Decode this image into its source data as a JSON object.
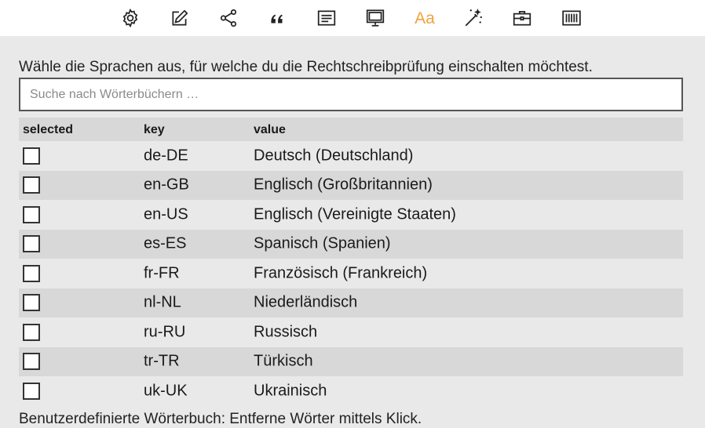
{
  "toolbar": {
    "items": [
      {
        "icon": "gear-icon"
      },
      {
        "icon": "edit-icon"
      },
      {
        "icon": "share-icon"
      },
      {
        "icon": "quote-icon"
      },
      {
        "icon": "text-lines-icon"
      },
      {
        "icon": "monitor-icon"
      },
      {
        "icon": "font-icon",
        "label": "Aa",
        "active": true,
        "color": "#f2a13a"
      },
      {
        "icon": "magic-wand-icon"
      },
      {
        "icon": "toolbox-icon"
      },
      {
        "icon": "barcode-icon"
      }
    ]
  },
  "spellcheck": {
    "intro": "Wähle die Sprachen aus, für welche du die Rechtschreibprüfung einschalten möchtest.",
    "search_placeholder": "Suche nach Wörterbüchern …",
    "columns": {
      "selected": "selected",
      "key": "key",
      "value": "value"
    },
    "rows": [
      {
        "selected": false,
        "key": "de-DE",
        "value": "Deutsch (Deutschland)"
      },
      {
        "selected": false,
        "key": "en-GB",
        "value": "Englisch (Großbritannien)"
      },
      {
        "selected": false,
        "key": "en-US",
        "value": "Englisch (Vereinigte Staaten)"
      },
      {
        "selected": false,
        "key": "es-ES",
        "value": "Spanisch (Spanien)"
      },
      {
        "selected": false,
        "key": "fr-FR",
        "value": "Französisch (Frankreich)"
      },
      {
        "selected": false,
        "key": "nl-NL",
        "value": "Niederländisch"
      },
      {
        "selected": false,
        "key": "ru-RU",
        "value": "Russisch"
      },
      {
        "selected": false,
        "key": "tr-TR",
        "value": "Türkisch"
      },
      {
        "selected": false,
        "key": "uk-UK",
        "value": "Ukrainisch"
      }
    ],
    "footer_text": "Benutzerdefinierte Wörterbuch: Entferne Wörter mittels Klick."
  }
}
